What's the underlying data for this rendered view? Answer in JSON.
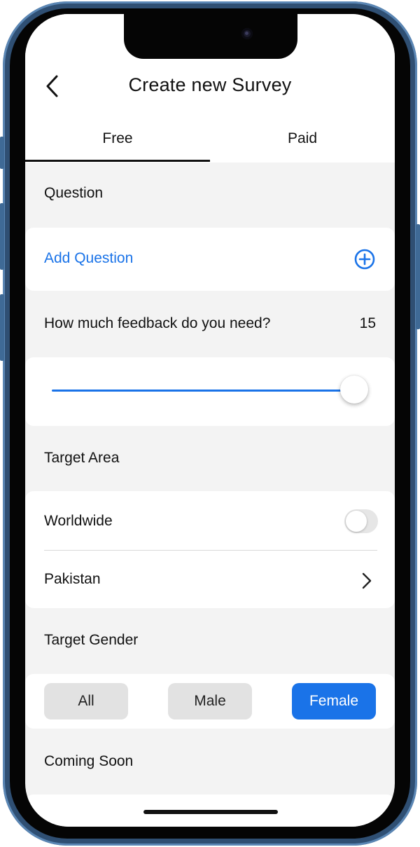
{
  "header": {
    "title": "Create new Survey",
    "tabs": [
      {
        "label": "Free",
        "selected": true
      },
      {
        "label": "Paid",
        "selected": false
      }
    ]
  },
  "question_section": {
    "label": "Question",
    "add_label": "Add Question",
    "add_icon": "plus-circle-icon"
  },
  "feedback": {
    "label": "How much feedback do you need?",
    "value": "15",
    "slider_fraction": 1.0
  },
  "target_area": {
    "label": "Target Area",
    "worldwide_label": "Worldwide",
    "worldwide_enabled": false,
    "country": "Pakistan"
  },
  "target_gender": {
    "label": "Target Gender",
    "options": [
      "All",
      "Male",
      "Female"
    ],
    "selected": "Female"
  },
  "coming_soon": {
    "label": "Coming Soon"
  },
  "colors": {
    "accent": "#1a73e8",
    "background": "#f3f3f3",
    "frame": "#2f4f73"
  }
}
